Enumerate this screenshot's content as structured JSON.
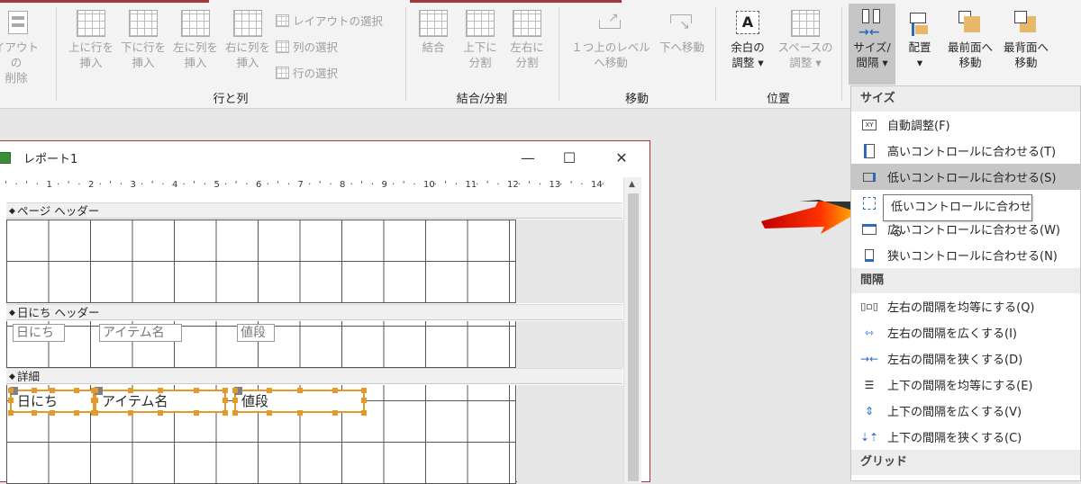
{
  "ribbon": {
    "partial_label": "イアウトの\n削除",
    "insert_row_above": "上に行を\n挿入",
    "insert_row_below": "下に行を\n挿入",
    "insert_col_left": "左に列を\n挿入",
    "insert_col_right": "右に列を\n挿入",
    "select_layout": "レイアウトの選択",
    "select_column": "列の選択",
    "select_row": "行の選択",
    "group_rows_cols": "行と列",
    "merge": "結合",
    "split_vert": "上下に\n分割",
    "split_horiz": "左右に\n分割",
    "group_merge_split": "結合/分割",
    "move_up": "１つ上のレベル\nへ移動",
    "move_down": "下へ移動",
    "group_move": "移動",
    "margins": "余白の\n調整 ▾",
    "spacing": "スペースの\n調整 ▾",
    "group_position": "位置",
    "size_space": "サイズ/\n間隔 ▾",
    "align": "配置\n▾",
    "bring_front": "最前面へ\n移動",
    "send_back": "最背面へ\n移動",
    "accent_color": "#a4373a"
  },
  "report": {
    "title": "レポート1",
    "minimize": "—",
    "maximize": "☐",
    "close": "✕",
    "ruler": [
      "1",
      "2",
      "3",
      "4",
      "5",
      "6",
      "7",
      "8",
      "9",
      "10",
      "11",
      "12",
      "13",
      "14"
    ],
    "page_header": "ページ ヘッダー",
    "day_header": "日にち ヘッダー",
    "detail": "詳細",
    "labels": [
      "日にち",
      "アイテム名",
      "値段"
    ],
    "fields": [
      "日にち",
      "アイテム名",
      "値段"
    ]
  },
  "menu": {
    "size_header": "サイズ",
    "size_items": [
      "自動調整(F)",
      "高いコントロールに合わせる(T)",
      "低いコントロールに合わせる(S)",
      "",
      "広いコントロールに合わせる(W)",
      "狭いコントロールに合わせる(N)"
    ],
    "spacing_header": "間隔",
    "spacing_items": [
      "左右の間隔を均等にする(Q)",
      "左右の間隔を広くする(I)",
      "左右の間隔を狭くする(D)",
      "上下の間隔を均等にする(E)",
      "上下の間隔を広くする(V)",
      "上下の間隔を狭くする(C)"
    ],
    "grid_header": "グリッド",
    "tooltip": "低いコントロールに合わせる",
    "xy_icon_text": "XY"
  }
}
